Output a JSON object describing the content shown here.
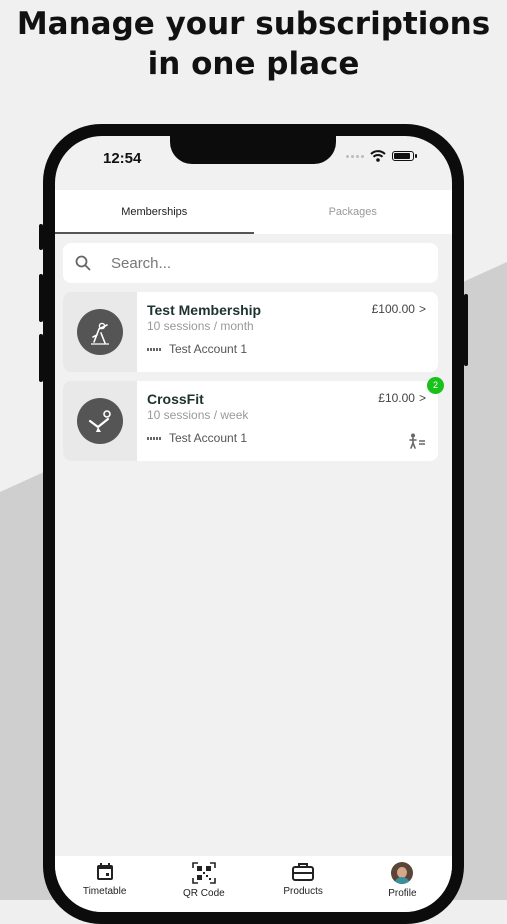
{
  "headline": {
    "line1": "Manage your subscriptions",
    "line2": "in one place"
  },
  "status_bar": {
    "time": "12:54"
  },
  "top_tabs": [
    {
      "label": "Memberships",
      "active": true
    },
    {
      "label": "Packages",
      "active": false
    }
  ],
  "search": {
    "placeholder": "Search..."
  },
  "memberships": [
    {
      "name": "Test Membership",
      "frequency": "10 sessions / month",
      "account": "Test Account 1",
      "price": "£100.00",
      "chevron": ">",
      "icon": "climbing-icon"
    },
    {
      "name": "CrossFit",
      "frequency": "10 sessions / week",
      "account": "Test Account 1",
      "price": "£10.00",
      "chevron": ">",
      "badge": "2",
      "icon": "kettlebell-swing-icon",
      "badge_color": "#18c21b"
    }
  ],
  "bottom_nav": [
    {
      "label": "Timetable",
      "icon": "calendar-icon"
    },
    {
      "label": "QR Code",
      "icon": "qr-code-icon"
    },
    {
      "label": "Products",
      "icon": "briefcase-icon"
    },
    {
      "label": "Profile",
      "icon": "avatar"
    }
  ]
}
